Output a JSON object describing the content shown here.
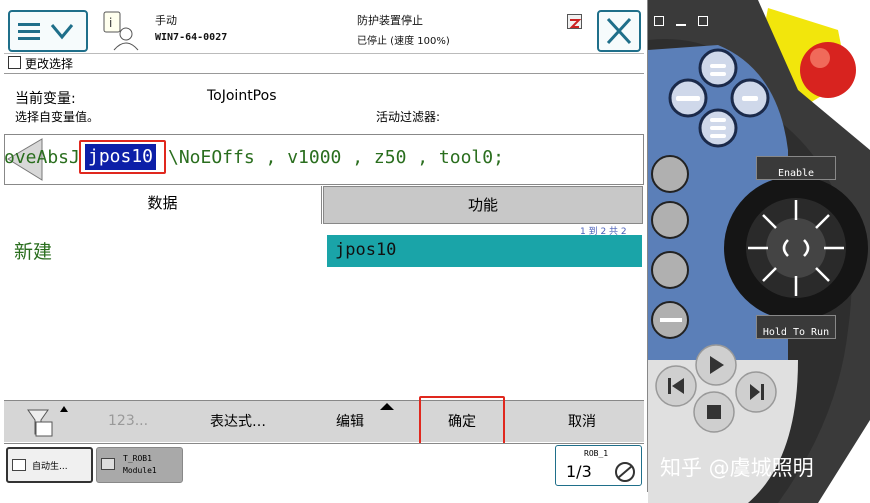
{
  "header": {
    "mode": "手动",
    "controller": "WIN7-64-0027",
    "safety": "防护装置停止",
    "status": "已停止 (速度 100%)"
  },
  "window": {
    "title": "更改选择"
  },
  "variable": {
    "current_label": "当前变量:",
    "current_value": "ToJointPos",
    "select_label": "选择自变量值。",
    "filter_label": "活动过滤器:"
  },
  "instruction": {
    "prefix": "oveAbsJ",
    "selected": "jpos10",
    "suffix": "\\NoEOffs , v1000 , z50 , tool0;"
  },
  "tabs": {
    "data": "数据",
    "function": "功能"
  },
  "list": {
    "count": "1 到 2 共 2",
    "new_label": "新建",
    "items": [
      "jpos10"
    ]
  },
  "toolbar": {
    "numeric": "123...",
    "expression": "表达式…",
    "edit": "编辑",
    "ok": "确定",
    "cancel": "取消"
  },
  "taskbar": {
    "item1": "自动生...",
    "item2_line1": "T_ROB1",
    "item2_line2": "Module1",
    "robot": "ROB_1",
    "ratio": "1/3"
  },
  "pendant": {
    "enable": "Enable",
    "hold": "Hold To Run"
  },
  "watermark": "知乎 @虞城照明"
}
